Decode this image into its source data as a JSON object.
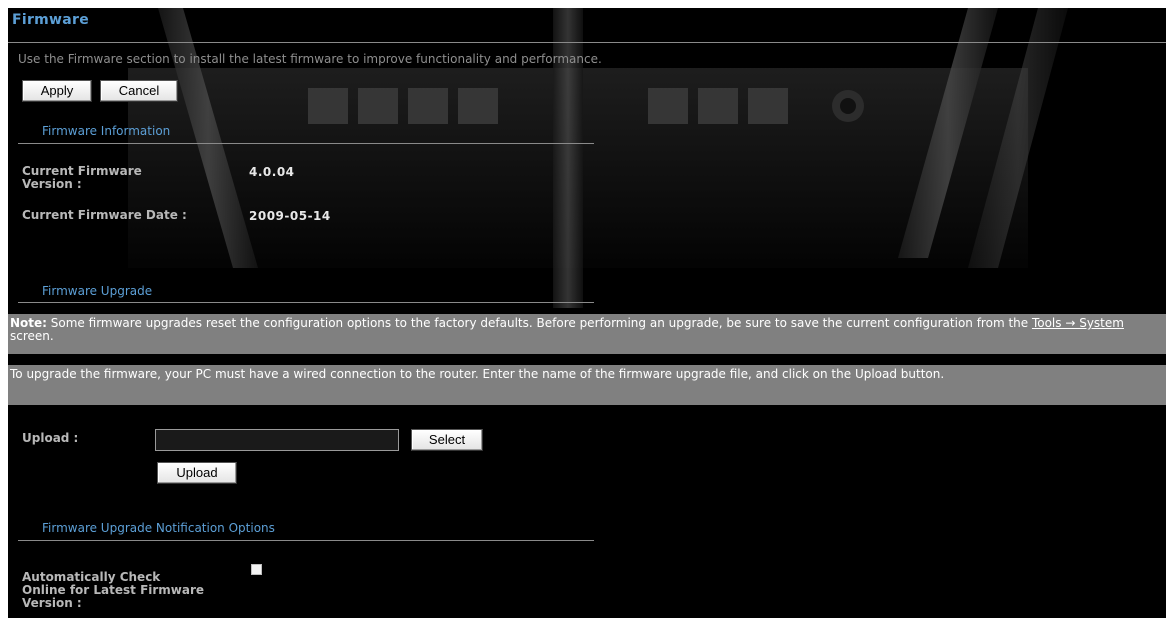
{
  "header": {
    "title": "Firmware",
    "intro": "Use the Firmware section to install the latest firmware to improve functionality and performance."
  },
  "toolbar": {
    "apply_label": "Apply",
    "cancel_label": "Cancel"
  },
  "firmware_info": {
    "heading": "Firmware Information",
    "version_label_line1": "Current Firmware",
    "version_label_line2": "Version :",
    "version_value": "4.0.04",
    "date_label": "Current Firmware Date :",
    "date_value": "2009-05-14"
  },
  "firmware_upgrade": {
    "heading": "Firmware Upgrade",
    "note_prefix": "Note:",
    "note_text": " Some firmware upgrades reset the configuration options to the factory defaults. Before performing an upgrade, be sure to save the current configuration from the ",
    "note_link": "Tools → System",
    "note_suffix": " screen.",
    "instructions": "To upgrade the firmware, your PC must have a wired connection to the router. Enter the name of the firmware upgrade file, and click on the Upload button.",
    "upload_label": "Upload :",
    "file_value": "",
    "select_label": "Select",
    "upload_button_label": "Upload"
  },
  "notification": {
    "heading": "Firmware Upgrade Notification Options",
    "auto_check_line1": "Automatically Check",
    "auto_check_line2": "Online for Latest Firmware",
    "auto_check_line3": "Version :",
    "auto_check_checked": false
  },
  "colors": {
    "accent": "#5c9fd6",
    "background": "#000000",
    "note_bg": "#808080"
  }
}
